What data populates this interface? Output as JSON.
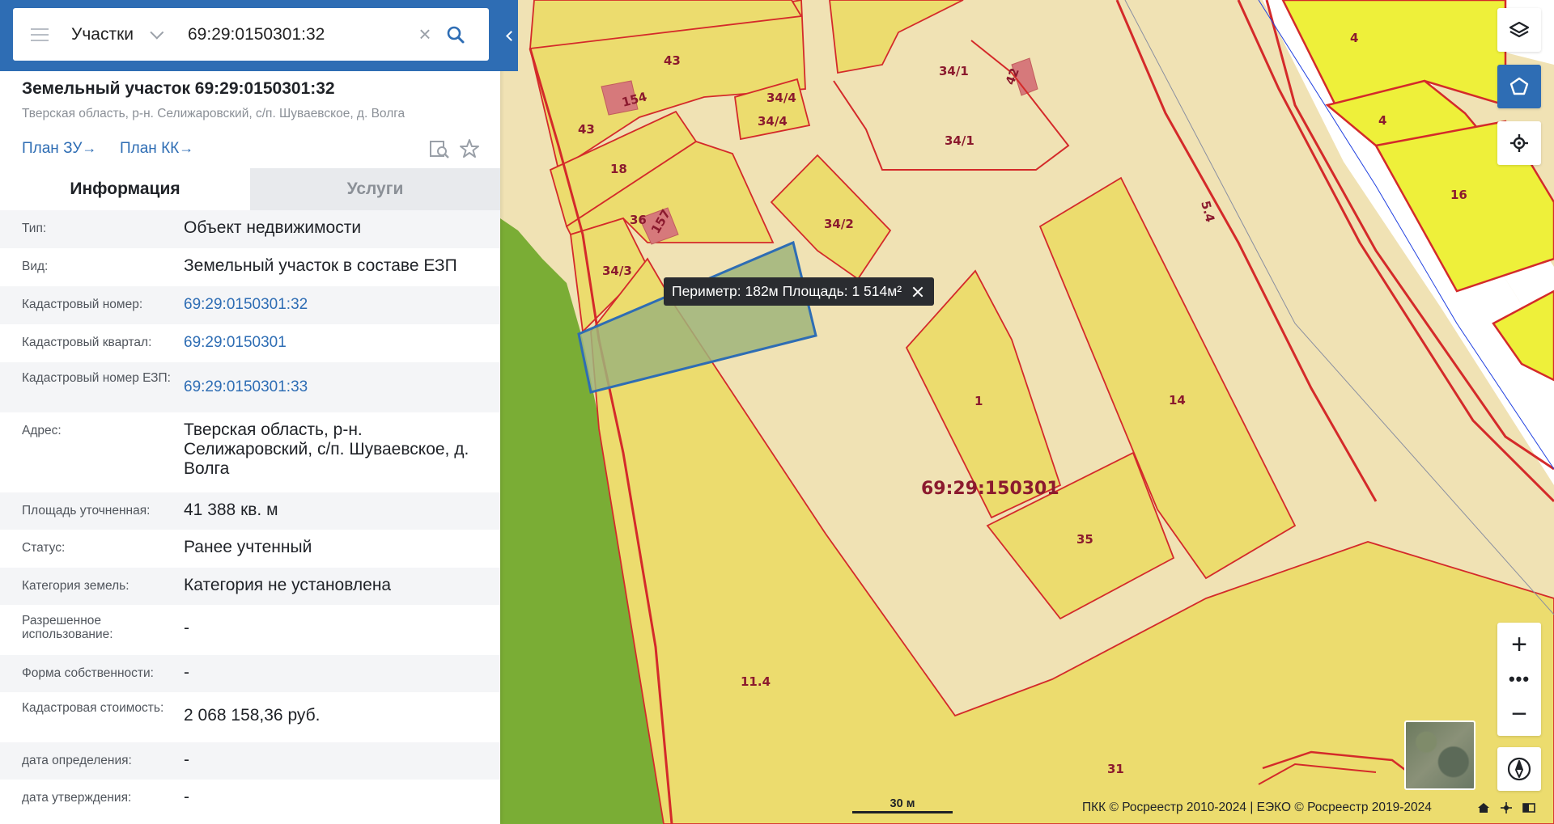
{
  "search": {
    "type_label": "Участки",
    "query": "69:29:0150301:32"
  },
  "object": {
    "title": "Земельный участок 69:29:0150301:32",
    "address": "Тверская область, р-н. Селижаровский, с/п. Шуваевское, д. Волга",
    "plan_zu": "План ЗУ",
    "plan_kk": "План КК",
    "arrow": "→"
  },
  "tabs": {
    "info": "Информация",
    "services": "Услуги"
  },
  "info": [
    {
      "label": "Тип:",
      "value": "Объект недвижимости"
    },
    {
      "label": "Вид:",
      "value": "Земельный участок в составе ЕЗП"
    },
    {
      "label": "Кадастровый номер:",
      "value": "69:29:0150301:32"
    },
    {
      "label": "Кадастровый квартал:",
      "value": "69:29:0150301"
    },
    {
      "label": "Кадастровый номер ЕЗП:",
      "value": "69:29:0150301:33"
    },
    {
      "label": "Адрес:",
      "value": "Тверская область, р-н. Селижаровский, с/п. Шуваевское, д. Волга"
    },
    {
      "label": "Площадь уточненная:",
      "value": "41 388 кв. м"
    },
    {
      "label": "Статус:",
      "value": "Ранее учтенный"
    },
    {
      "label": "Категория земель:",
      "value": "Категория не установлена"
    },
    {
      "label": "Разрешенное использование:",
      "value": "-"
    },
    {
      "label": "Форма собственности:",
      "value": "-"
    },
    {
      "label": "Кадастровая стоимость:",
      "value": "2 068 158,36 руб."
    },
    {
      "label": "дата определения:",
      "value": "-"
    },
    {
      "label": "дата утверждения:",
      "value": "-"
    }
  ],
  "map": {
    "tooltip": "Периметр: 182м Площадь: 1 514м²",
    "quarter_label": "69:29:150301",
    "parcel_labels": [
      "43",
      "154",
      "43",
      "18",
      "36",
      "157",
      "34/3",
      "34/4",
      "34/4",
      "34/1",
      "34/1",
      "42",
      "34/2",
      "1",
      "14",
      "35",
      "11.4",
      "31",
      "4",
      "4",
      "16",
      "5.4"
    ],
    "scale_label": "30 м",
    "copyright": "ПКК © Росреестр 2010-2024 | ЕЭКО © Росреестр 2019-2024",
    "zoom_in": "+",
    "zoom_more": "•••",
    "zoom_out": "−"
  },
  "colors": {
    "accent": "#2e6db4",
    "parcel_fill": "#ecdc6e",
    "background_fill": "#f0e2b4",
    "border_red": "#d42a2a",
    "forest": "#7aad35",
    "road_yellow": "#eef03a",
    "selection_fill": "#9fb47a"
  },
  "icons": {
    "menu": "menu-icon",
    "search": "search-icon",
    "clear": "close-icon",
    "find_on_map": "find-on-map-icon",
    "favorite": "star-icon",
    "layers": "layers-icon",
    "select": "select-area-icon",
    "locate": "locate-icon",
    "compass": "compass-icon"
  }
}
